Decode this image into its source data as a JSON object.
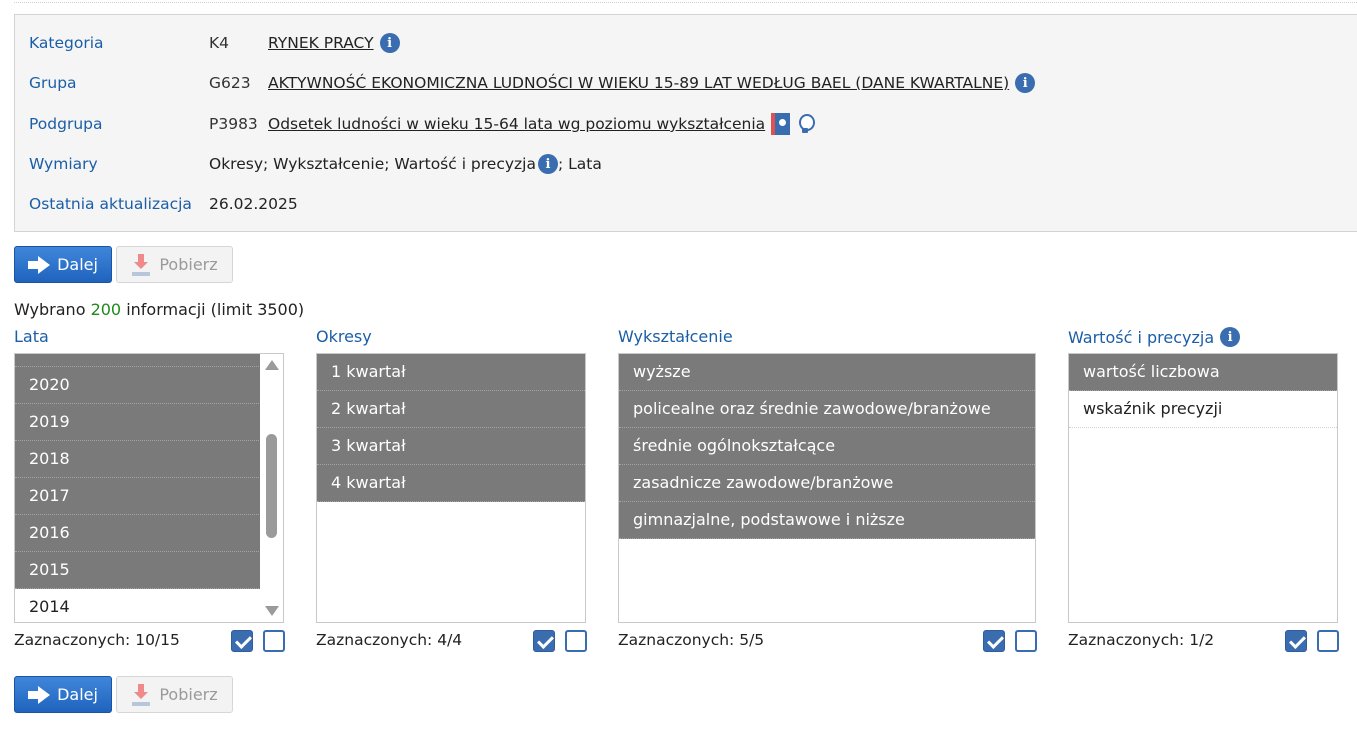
{
  "meta": {
    "category": {
      "label": "Kategoria",
      "code": "K4",
      "value": "RYNEK PRACY"
    },
    "group": {
      "label": "Grupa",
      "code": "G623",
      "value": "AKTYWNOŚĆ EKONOMICZNA LUDNOŚCI W WIEKU 15-89 LAT WEDŁUG BAEL (DANE KWARTALNE)"
    },
    "subgroup": {
      "label": "Podgrupa",
      "code": "P3983",
      "value": "Odsetek ludności w wieku 15-64 lata wg poziomu wykształcenia"
    },
    "dimensions": {
      "label": "Wymiary",
      "part1": "Okresy; Wykształcenie; Wartość i precyzja",
      "part2": "; Lata"
    },
    "updated": {
      "label": "Ostatnia aktualizacja",
      "value": "26.02.2025"
    }
  },
  "buttons": {
    "next": "Dalej",
    "download": "Pobierz"
  },
  "summary": {
    "prefix": "Wybrano ",
    "count": "200",
    "suffix": " informacji (limit 3500)"
  },
  "columns": {
    "years": {
      "title": "Lata",
      "items": [
        {
          "label": "",
          "selected": true
        },
        {
          "label": "2020",
          "selected": true
        },
        {
          "label": "2019",
          "selected": true
        },
        {
          "label": "2018",
          "selected": true
        },
        {
          "label": "2017",
          "selected": true
        },
        {
          "label": "2016",
          "selected": true
        },
        {
          "label": "2015",
          "selected": true
        },
        {
          "label": "2014",
          "selected": false
        }
      ],
      "count": "Zaznaczonych: 10/15"
    },
    "periods": {
      "title": "Okresy",
      "items": [
        {
          "label": "1 kwartał",
          "selected": true
        },
        {
          "label": "2 kwartał",
          "selected": true
        },
        {
          "label": "3 kwartał",
          "selected": true
        },
        {
          "label": "4 kwartał",
          "selected": true
        }
      ],
      "count": "Zaznaczonych: 4/4"
    },
    "education": {
      "title": "Wykształcenie",
      "items": [
        {
          "label": "wyższe",
          "selected": true
        },
        {
          "label": "policealne oraz średnie zawodowe/branżowe",
          "selected": true
        },
        {
          "label": "średnie ogólnokształcące",
          "selected": true
        },
        {
          "label": "zasadnicze zawodowe/branżowe",
          "selected": true
        },
        {
          "label": "gimnazjalne, podstawowe i niższe",
          "selected": true
        }
      ],
      "count": "Zaznaczonych: 5/5"
    },
    "value": {
      "title": "Wartość i precyzja",
      "items": [
        {
          "label": "wartość liczbowa",
          "selected": true
        },
        {
          "label": "wskaźnik precyzji",
          "selected": false
        }
      ],
      "count": "Zaznaczonych: 1/2"
    }
  },
  "icons": {
    "info": "i"
  },
  "colors": {
    "accent": "#1b5ea6",
    "selected_row": "#7a7a7a",
    "button": "#2a6fcb",
    "count_green": "#1e8a1e"
  }
}
